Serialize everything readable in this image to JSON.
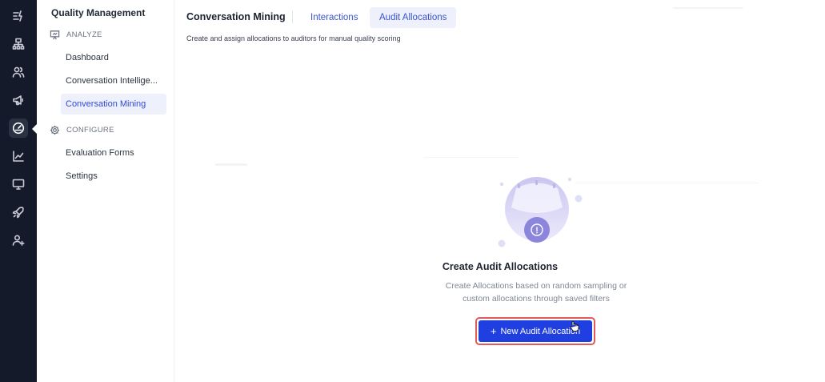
{
  "sidebar": {
    "title": "Quality Management",
    "sections": [
      {
        "heading": "ANALYZE",
        "icon": "presentation-icon",
        "items": [
          {
            "label": "Dashboard",
            "active": false
          },
          {
            "label": "Conversation Intellige...",
            "active": false
          },
          {
            "label": "Conversation Mining",
            "active": true
          }
        ]
      },
      {
        "heading": "CONFIGURE",
        "icon": "gear-icon",
        "items": [
          {
            "label": "Evaluation Forms",
            "active": false
          },
          {
            "label": "Settings",
            "active": false
          }
        ]
      }
    ]
  },
  "rail": {
    "icons": [
      "lightning-list-icon",
      "sitemap-icon",
      "users-icon",
      "megaphone-icon",
      "gauge-icon",
      "line-chart-icon",
      "monitor-icon",
      "rocket-icon",
      "user-plus-icon"
    ],
    "active_index": 4
  },
  "header": {
    "title": "Conversation Mining",
    "tabs": [
      {
        "label": "Interactions",
        "active": false
      },
      {
        "label": "Audit Allocations",
        "active": true
      }
    ],
    "subtitle": "Create and assign allocations to auditors for manual quality scoring"
  },
  "empty_state": {
    "illustration_icon": "info-circle-icon",
    "title": "Create Audit Allocations",
    "description_line1": "Create Allocations based on random sampling or",
    "description_line2": "custom allocations through saved filters",
    "button_label": "New Audit Allocation",
    "button_icon": "plus-icon"
  },
  "colors": {
    "rail_bg": "#141a29",
    "accent": "#1f3fe0",
    "tab_text": "#3c55cf",
    "active_bg": "#eef1fb",
    "highlight_border": "#e25a5a"
  }
}
